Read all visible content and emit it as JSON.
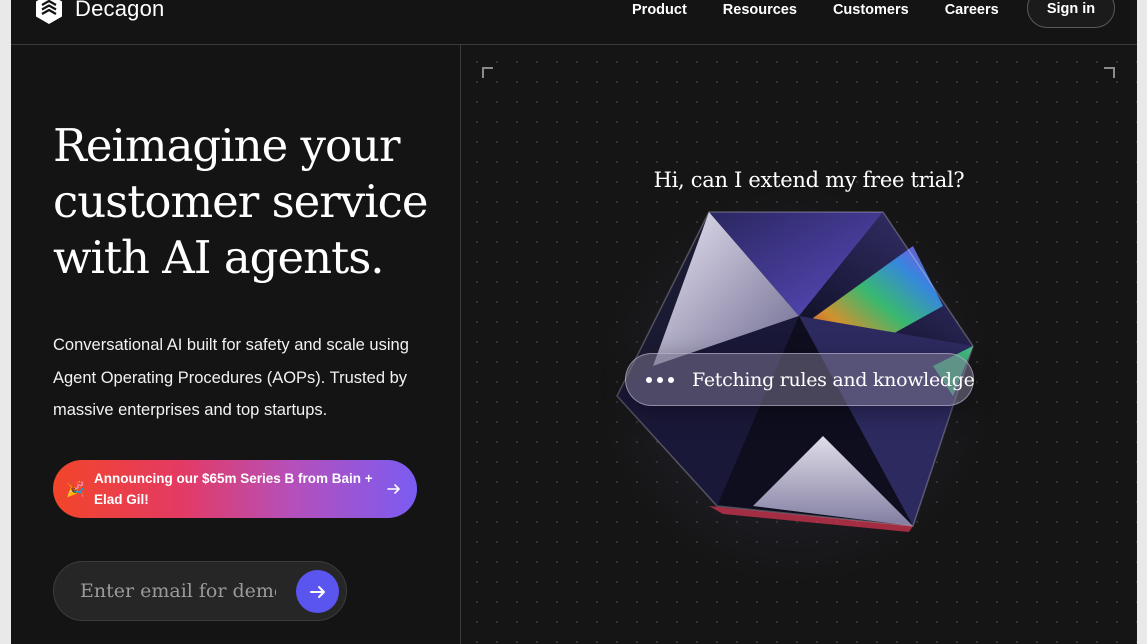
{
  "brand": {
    "name": "Decagon",
    "logo_icon": "decagon-logo-icon"
  },
  "nav": {
    "links": [
      "Product",
      "Resources",
      "Customers",
      "Careers"
    ],
    "signin_label": "Sign in"
  },
  "hero": {
    "headline": "Reimagine your customer service with AI agents.",
    "subcopy": "Conversational AI built for safety and scale using Agent Operating Procedures (AOPs). Trusted by massive enterprises and top startups.",
    "announcement": {
      "icon": "party-popper-icon",
      "text": "Announcing our $65m Series B from Bain + Elad Gil!",
      "arrow_icon": "arrow-right-icon"
    },
    "email": {
      "placeholder": "Enter email for demo",
      "value": "",
      "submit_icon": "arrow-right-icon"
    }
  },
  "demo": {
    "question": "Hi, can I extend my free trial?",
    "status_text": "Fetching rules and knowledge"
  },
  "colors": {
    "background": "#141414",
    "accent": "#5b55f0",
    "announce_gradient": [
      "#f2452a",
      "#e43a63",
      "#b64fb9",
      "#7b5cf2"
    ]
  }
}
